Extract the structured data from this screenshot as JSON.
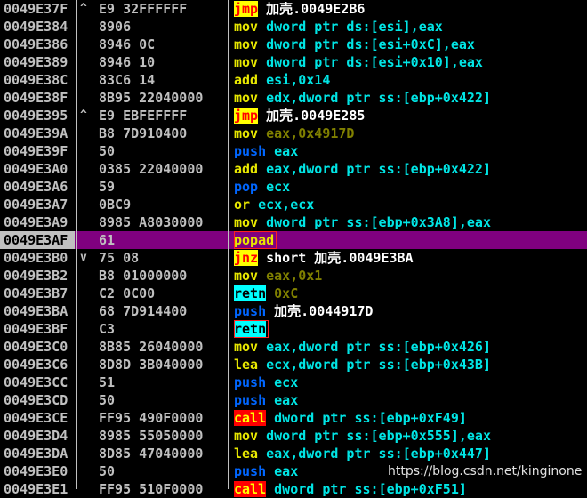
{
  "disassembly": [
    {
      "addr": "0049E37F",
      "jm": "^",
      "hex": "E9 32FFFFFF",
      "mnem": "jmp",
      "kind": "jmp",
      "ops": "加壳.0049E2B6",
      "opkind": "lbl"
    },
    {
      "addr": "0049E384",
      "jm": "",
      "hex": "8906",
      "mnem": "mov",
      "kind": "",
      "ops": "dword ptr ds:[esi],eax",
      "opkind": ""
    },
    {
      "addr": "0049E386",
      "jm": "",
      "hex": "8946 0C",
      "mnem": "mov",
      "kind": "",
      "ops": "dword ptr ds:[esi+0xC],eax",
      "opkind": ""
    },
    {
      "addr": "0049E389",
      "jm": "",
      "hex": "8946 10",
      "mnem": "mov",
      "kind": "",
      "ops": "dword ptr ds:[esi+0x10],eax",
      "opkind": ""
    },
    {
      "addr": "0049E38C",
      "jm": "",
      "hex": "83C6 14",
      "mnem": "add",
      "kind": "",
      "ops": "esi,0x14",
      "opkind": ""
    },
    {
      "addr": "0049E38F",
      "jm": "",
      "hex": "8B95 22040000",
      "mnem": "mov",
      "kind": "",
      "ops": "edx,dword ptr ss:[ebp+0x422]",
      "opkind": ""
    },
    {
      "addr": "0049E395",
      "jm": "^",
      "hex": "E9 EBFEFFFF",
      "mnem": "jmp",
      "kind": "jmp",
      "ops": "加壳.0049E285",
      "opkind": "lbl"
    },
    {
      "addr": "0049E39A",
      "jm": "",
      "hex": "B8 7D910400",
      "mnem": "mov",
      "kind": "",
      "ops": "eax,0x4917D",
      "opkind": "imm"
    },
    {
      "addr": "0049E39F",
      "jm": "",
      "hex": "50",
      "mnem": "push",
      "kind": "stk",
      "ops": "eax",
      "opkind": ""
    },
    {
      "addr": "0049E3A0",
      "jm": "",
      "hex": "0385 22040000",
      "mnem": "add",
      "kind": "",
      "ops": "eax,dword ptr ss:[ebp+0x422]",
      "opkind": ""
    },
    {
      "addr": "0049E3A6",
      "jm": "",
      "hex": "59",
      "mnem": "pop",
      "kind": "stk",
      "ops": "ecx",
      "opkind": ""
    },
    {
      "addr": "0049E3A7",
      "jm": "",
      "hex": "0BC9",
      "mnem": "or",
      "kind": "",
      "ops": "ecx,ecx",
      "opkind": ""
    },
    {
      "addr": "0049E3A9",
      "jm": "",
      "hex": "8985 A8030000",
      "mnem": "mov",
      "kind": "",
      "ops": "dword ptr ss:[ebp+0x3A8],eax",
      "opkind": ""
    },
    {
      "addr": "0049E3AF",
      "jm": "",
      "hex": "61",
      "mnem": "popad",
      "kind": "",
      "ops": "",
      "opkind": ""
    },
    {
      "addr": "0049E3B0",
      "jm": "v",
      "hex": "75 08",
      "mnem": "jnz",
      "kind": "jmp",
      "ops": "short 加壳.0049E3BA",
      "opkind": "lbl"
    },
    {
      "addr": "0049E3B2",
      "jm": "",
      "hex": "B8 01000000",
      "mnem": "mov",
      "kind": "",
      "ops": "eax,0x1",
      "opkind": "imm"
    },
    {
      "addr": "0049E3B7",
      "jm": "",
      "hex": "C2 0C00",
      "mnem": "retn",
      "kind": "retn",
      "ops": "0xC",
      "opkind": "imm"
    },
    {
      "addr": "0049E3BA",
      "jm": "",
      "hex": "68 7D914400",
      "mnem": "push",
      "kind": "stk",
      "ops": "加壳.0044917D",
      "opkind": "lbl"
    },
    {
      "addr": "0049E3BF",
      "jm": "",
      "hex": "C3",
      "mnem": "retn",
      "kind": "retn",
      "ops": "",
      "opkind": ""
    },
    {
      "addr": "0049E3C0",
      "jm": "",
      "hex": "8B85 26040000",
      "mnem": "mov",
      "kind": "",
      "ops": "eax,dword ptr ss:[ebp+0x426]",
      "opkind": ""
    },
    {
      "addr": "0049E3C6",
      "jm": "",
      "hex": "8D8D 3B040000",
      "mnem": "lea",
      "kind": "",
      "ops": "ecx,dword ptr ss:[ebp+0x43B]",
      "opkind": ""
    },
    {
      "addr": "0049E3CC",
      "jm": "",
      "hex": "51",
      "mnem": "push",
      "kind": "stk",
      "ops": "ecx",
      "opkind": ""
    },
    {
      "addr": "0049E3CD",
      "jm": "",
      "hex": "50",
      "mnem": "push",
      "kind": "stk",
      "ops": "eax",
      "opkind": ""
    },
    {
      "addr": "0049E3CE",
      "jm": "",
      "hex": "FF95 490F0000",
      "mnem": "call",
      "kind": "call",
      "ops": "dword ptr ss:[ebp+0xF49]",
      "opkind": ""
    },
    {
      "addr": "0049E3D4",
      "jm": "",
      "hex": "8985 55050000",
      "mnem": "mov",
      "kind": "",
      "ops": "dword ptr ss:[ebp+0x555],eax",
      "opkind": ""
    },
    {
      "addr": "0049E3DA",
      "jm": "",
      "hex": "8D85 47040000",
      "mnem": "lea",
      "kind": "",
      "ops": "eax,dword ptr ss:[ebp+0x447]",
      "opkind": ""
    },
    {
      "addr": "0049E3E0",
      "jm": "",
      "hex": "50",
      "mnem": "push",
      "kind": "stk",
      "ops": "eax",
      "opkind": ""
    },
    {
      "addr": "0049E3E1",
      "jm": "",
      "hex": "FF95 510F0000",
      "mnem": "call",
      "kind": "call",
      "ops": "dword ptr ss:[ebp+0xF51]",
      "opkind": ""
    }
  ],
  "selected_addr": "0049E3AF",
  "boxed_addrs": [
    "0049E3AF",
    "0049E3BF"
  ],
  "watermark": "https://blog.csdn.net/kinginone",
  "colors": {
    "selection": "#80007f",
    "address_selected_bg": "#c0c0c0",
    "mnemonic": "#e8e800",
    "operand": "#00e5e5",
    "highlight_box": "#ff2020"
  }
}
